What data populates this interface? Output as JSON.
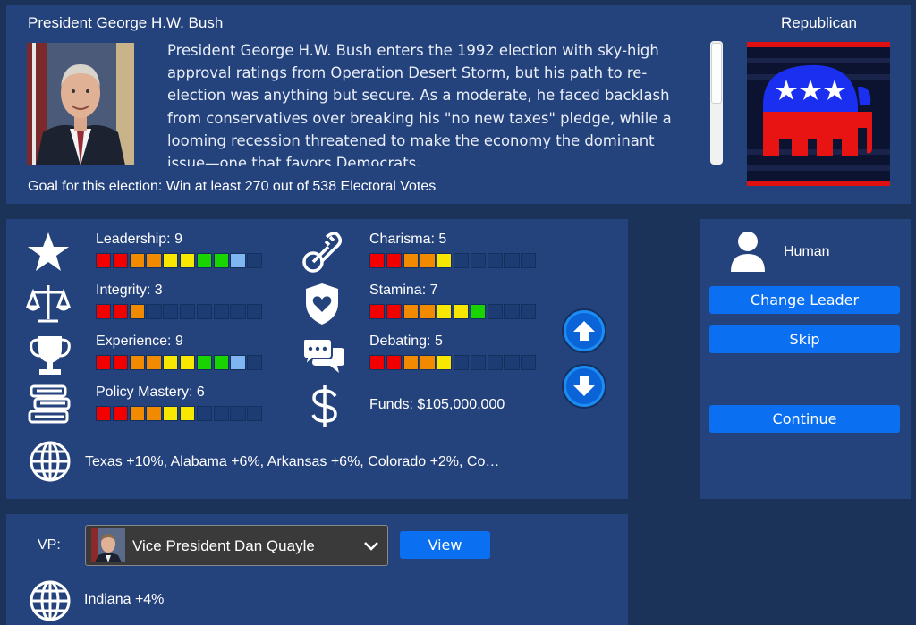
{
  "leader": {
    "name": "President George H.W. Bush",
    "party": "Republican",
    "bio": "President George H.W. Bush enters the 1992 election with sky-high approval ratings from Operation Desert Storm, but his path to re-election was anything but secure. As a moderate, he faced backlash from conservatives over breaking his \"no new taxes\" pledge, while a looming recession threatened to make the economy the dominant issue—one that favors Democrats.",
    "goal": "Goal for this election: Win at least 270 out of 538 Electoral Votes"
  },
  "stats": {
    "leadership": {
      "label": "Leadership: 9",
      "value": 9,
      "icon": "star-icon"
    },
    "integrity": {
      "label": "Integrity: 3",
      "value": 3,
      "icon": "scales-icon"
    },
    "experience": {
      "label": "Experience: 9",
      "value": 9,
      "icon": "trophy-icon"
    },
    "policy": {
      "label": "Policy Mastery: 6",
      "value": 6,
      "icon": "books-icon"
    },
    "charisma": {
      "label": "Charisma: 5",
      "value": 5,
      "icon": "thermometer-icon"
    },
    "stamina": {
      "label": "Stamina: 7",
      "value": 7,
      "icon": "heart-shield-icon"
    },
    "debating": {
      "label": "Debating: 5",
      "value": 5,
      "icon": "speech-bubbles-icon"
    },
    "max": 10,
    "funds": "Funds: $105,000,000",
    "regions": "Texas +10%, Alabama +6%, Arkansas +6%, Colorado +2%, Co…"
  },
  "bar_colors": [
    "#f20000",
    "#f20000",
    "#f28a00",
    "#f28a00",
    "#f8e800",
    "#f8e800",
    "#1ad400",
    "#1ad400",
    "#7fb6f2",
    "#7fb6f2"
  ],
  "side": {
    "player_type": "Human",
    "change_leader": "Change Leader",
    "skip": "Skip",
    "continue": "Continue"
  },
  "vp": {
    "label": "VP:",
    "selected": "Vice President Dan Quayle",
    "view": "View",
    "region": "Indiana +4%"
  }
}
